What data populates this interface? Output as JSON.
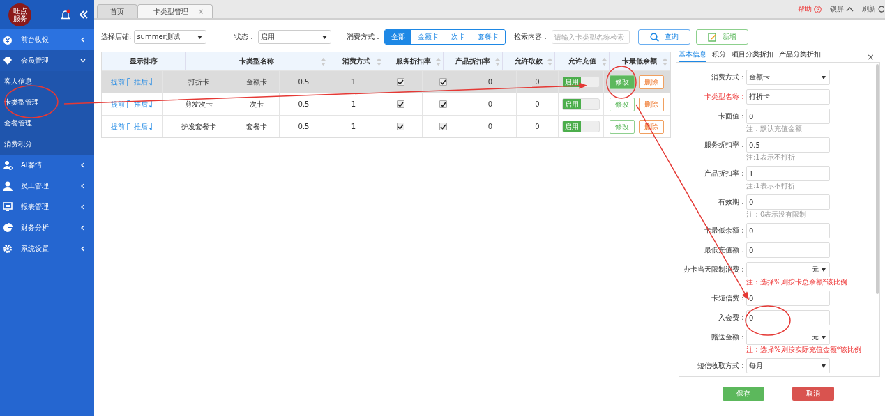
{
  "sidebar": {
    "logo": [
      "旺点",
      "服务"
    ],
    "items": [
      {
        "label": "前台收银",
        "selected": true,
        "expanded": false
      },
      {
        "label": "会员管理",
        "selected": false,
        "expanded": true,
        "children": [
          {
            "label": "客人信息"
          },
          {
            "label": "卡类型管理"
          },
          {
            "label": "套餐管理"
          },
          {
            "label": "消费积分"
          }
        ]
      },
      {
        "label": "AI客情",
        "selected": false,
        "expanded": false
      },
      {
        "label": "员工管理",
        "selected": false,
        "expanded": false
      },
      {
        "label": "报表管理",
        "selected": false,
        "expanded": false
      },
      {
        "label": "财务分析",
        "selected": false,
        "expanded": false
      },
      {
        "label": "系统设置",
        "selected": false,
        "expanded": false
      }
    ]
  },
  "tabs": [
    {
      "label": "首页",
      "selected": false
    },
    {
      "label": "卡类型管理",
      "selected": true,
      "close": "×"
    }
  ],
  "top_actions": {
    "help": "帮助",
    "lock": "锁屏",
    "refresh": "刷新"
  },
  "filters": {
    "store_label": "选择店铺:",
    "store": "summer测试",
    "status_label": "状态：",
    "status": "启用",
    "mode_label": "消费方式：",
    "modes": [
      {
        "label": "全部",
        "selected": true
      },
      {
        "label": "金额卡",
        "selected": false
      },
      {
        "label": "次卡",
        "selected": false
      },
      {
        "label": "套餐卡",
        "selected": false
      }
    ],
    "search_label": "检索内容：",
    "search_placeholder": "请输入卡类型名称检索",
    "query": "查询",
    "add": "新增"
  },
  "table": {
    "header": [
      {
        "label": "显示排序",
        "sortable": false
      },
      {
        "label": "卡类型名称",
        "sortable": true
      },
      {
        "label": "消费方式",
        "sortable": true
      },
      {
        "label": "服务折扣率",
        "sortable": true
      },
      {
        "label": "产品折扣率",
        "sortable": true
      },
      {
        "label": "允许取款",
        "sortable": true
      },
      {
        "label": "允许充值",
        "sortable": true
      },
      {
        "label": "卡最低余额",
        "sortable": true
      }
    ],
    "rows": [
      {
        "selected": true,
        "up": "提前",
        "down": "推后",
        "cells": [
          "打折卡",
          "金额卡",
          "0.5",
          "1"
        ],
        "checks": [
          true,
          true
        ],
        "values": [
          "0",
          "0"
        ],
        "toggle": {
          "label": "启用",
          "on": true
        },
        "edit": "修改",
        "delete": "删除"
      },
      {
        "selected": false,
        "up": "提前",
        "down": "推后",
        "cells": [
          "剪发次卡",
          "次卡",
          "0.5",
          "1"
        ],
        "checks": [
          true,
          true
        ],
        "values": [
          "0",
          "0"
        ],
        "toggle": {
          "label": "启用",
          "on": true
        },
        "edit": "修改",
        "delete": "删除"
      },
      {
        "selected": false,
        "up": "提前",
        "down": "推后",
        "cells": [
          "护发套餐卡",
          "套餐卡",
          "0.5",
          "1"
        ],
        "checks": [
          true,
          true
        ],
        "values": [
          "0",
          "0"
        ],
        "toggle": {
          "label": "启用",
          "on": true
        },
        "edit": "修改",
        "delete": "删除"
      }
    ]
  },
  "panel": {
    "tabs": [
      {
        "label": "基本信息",
        "selected": true
      },
      {
        "label": "积分",
        "selected": false
      },
      {
        "label": "项目分类折扣",
        "selected": false
      },
      {
        "label": "产品分类折扣",
        "selected": false
      }
    ],
    "close": "×",
    "fields": [
      {
        "label": "消费方式：",
        "kind": "select",
        "value": "金额卡",
        "required": false
      },
      {
        "label": "卡类型名称：",
        "kind": "input",
        "value": "打折卡",
        "required": true
      },
      {
        "label": "卡面值：",
        "kind": "input",
        "value": "0",
        "required": false,
        "note": {
          "text": "注：默认充值金额",
          "warning": false
        }
      },
      {
        "label": "服务折扣率：",
        "kind": "input",
        "value": "0.5",
        "required": false,
        "note": {
          "text": "注:1表示不打折",
          "warning": false
        }
      },
      {
        "label": "产品折扣率：",
        "kind": "input",
        "value": "1",
        "required": false,
        "note": {
          "text": "注:1表示不打折",
          "warning": false
        }
      },
      {
        "label": "有效期：",
        "kind": "input",
        "value": "0",
        "required": false,
        "note": {
          "text": "注：0表示没有限制",
          "warning": false
        }
      },
      {
        "label": "卡最低余额：",
        "kind": "input",
        "value": "0",
        "required": false
      },
      {
        "label": "最低充值额：",
        "kind": "input",
        "value": "0",
        "required": false
      },
      {
        "label": "办卡当天限制消费：",
        "kind": "select",
        "unit": "元",
        "required": false,
        "note": {
          "text": "注：选择%则按卡总余额*该比例",
          "warning": true
        }
      },
      {
        "label": "卡短信费：",
        "kind": "input",
        "value": "0",
        "required": false
      },
      {
        "label": "入会费：",
        "kind": "input",
        "value": "0",
        "required": false
      },
      {
        "label": "赠送金额：",
        "kind": "select",
        "unit": "元",
        "required": false,
        "note": {
          "text": "注：选择%则按实际充值金额*该比例",
          "warning": true
        }
      },
      {
        "label": "短信收取方式：",
        "kind": "select",
        "value": "每月",
        "required": false
      }
    ],
    "save": "保存",
    "cancel": "取消"
  }
}
